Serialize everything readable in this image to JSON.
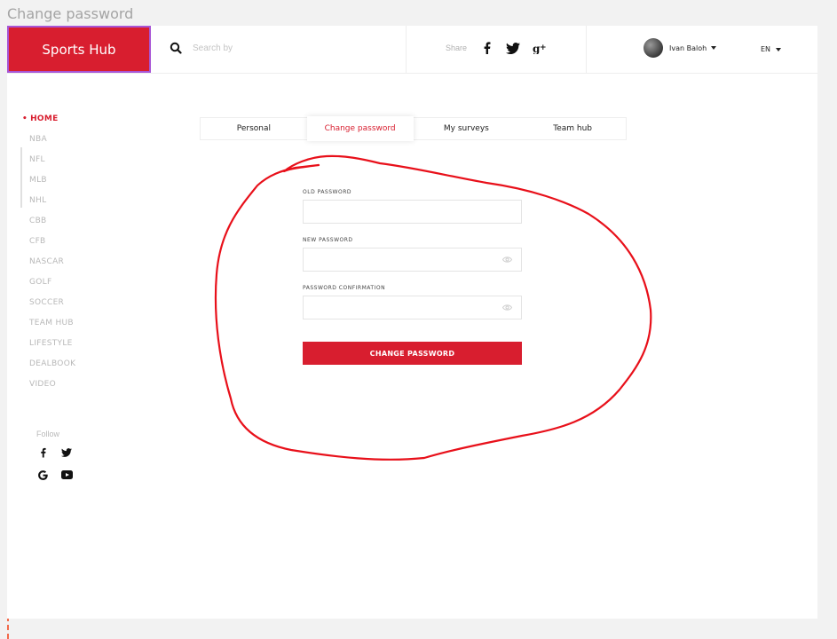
{
  "frame_title": "Change password",
  "header": {
    "logo_text": "Sports Hub",
    "search_placeholder": "Search by",
    "share_label": "Share",
    "share_icons": [
      "facebook-icon",
      "twitter-icon",
      "google-plus-icon"
    ],
    "user_name": "Ivan Baloh",
    "language": "EN"
  },
  "sidebar": {
    "items": [
      {
        "label": "HOME",
        "active": true
      },
      {
        "label": "NBA"
      },
      {
        "label": "NFL"
      },
      {
        "label": "MLB"
      },
      {
        "label": "NHL"
      },
      {
        "label": "CBB"
      },
      {
        "label": "CFB"
      },
      {
        "label": "NASCAR"
      },
      {
        "label": "GOLF"
      },
      {
        "label": "SOCCER"
      },
      {
        "label": "TEAM HUB"
      },
      {
        "label": "LIFESTYLE"
      },
      {
        "label": "DEALBOOK"
      },
      {
        "label": "VIDEO"
      }
    ],
    "follow_label": "Follow",
    "follow_icons": [
      "facebook-icon",
      "twitter-icon",
      "google-icon",
      "youtube-icon"
    ]
  },
  "tabs": [
    {
      "label": "Personal"
    },
    {
      "label": "Change password",
      "active": true
    },
    {
      "label": "My surveys"
    },
    {
      "label": "Team hub"
    }
  ],
  "form": {
    "old_password_label": "OLD PASSWORD",
    "old_password_value": "",
    "new_password_label": "NEW PASSWORD",
    "new_password_value": "",
    "confirm_password_label": "PASSWORD CONFIRMATION",
    "confirm_password_value": "",
    "submit_label": "CHANGE PASSWORD"
  },
  "colors": {
    "brand_red": "#d81e2f",
    "logo_outline": "#a855d6",
    "annotation_red": "#e8101a",
    "guide_dash": "#f26a4b"
  }
}
